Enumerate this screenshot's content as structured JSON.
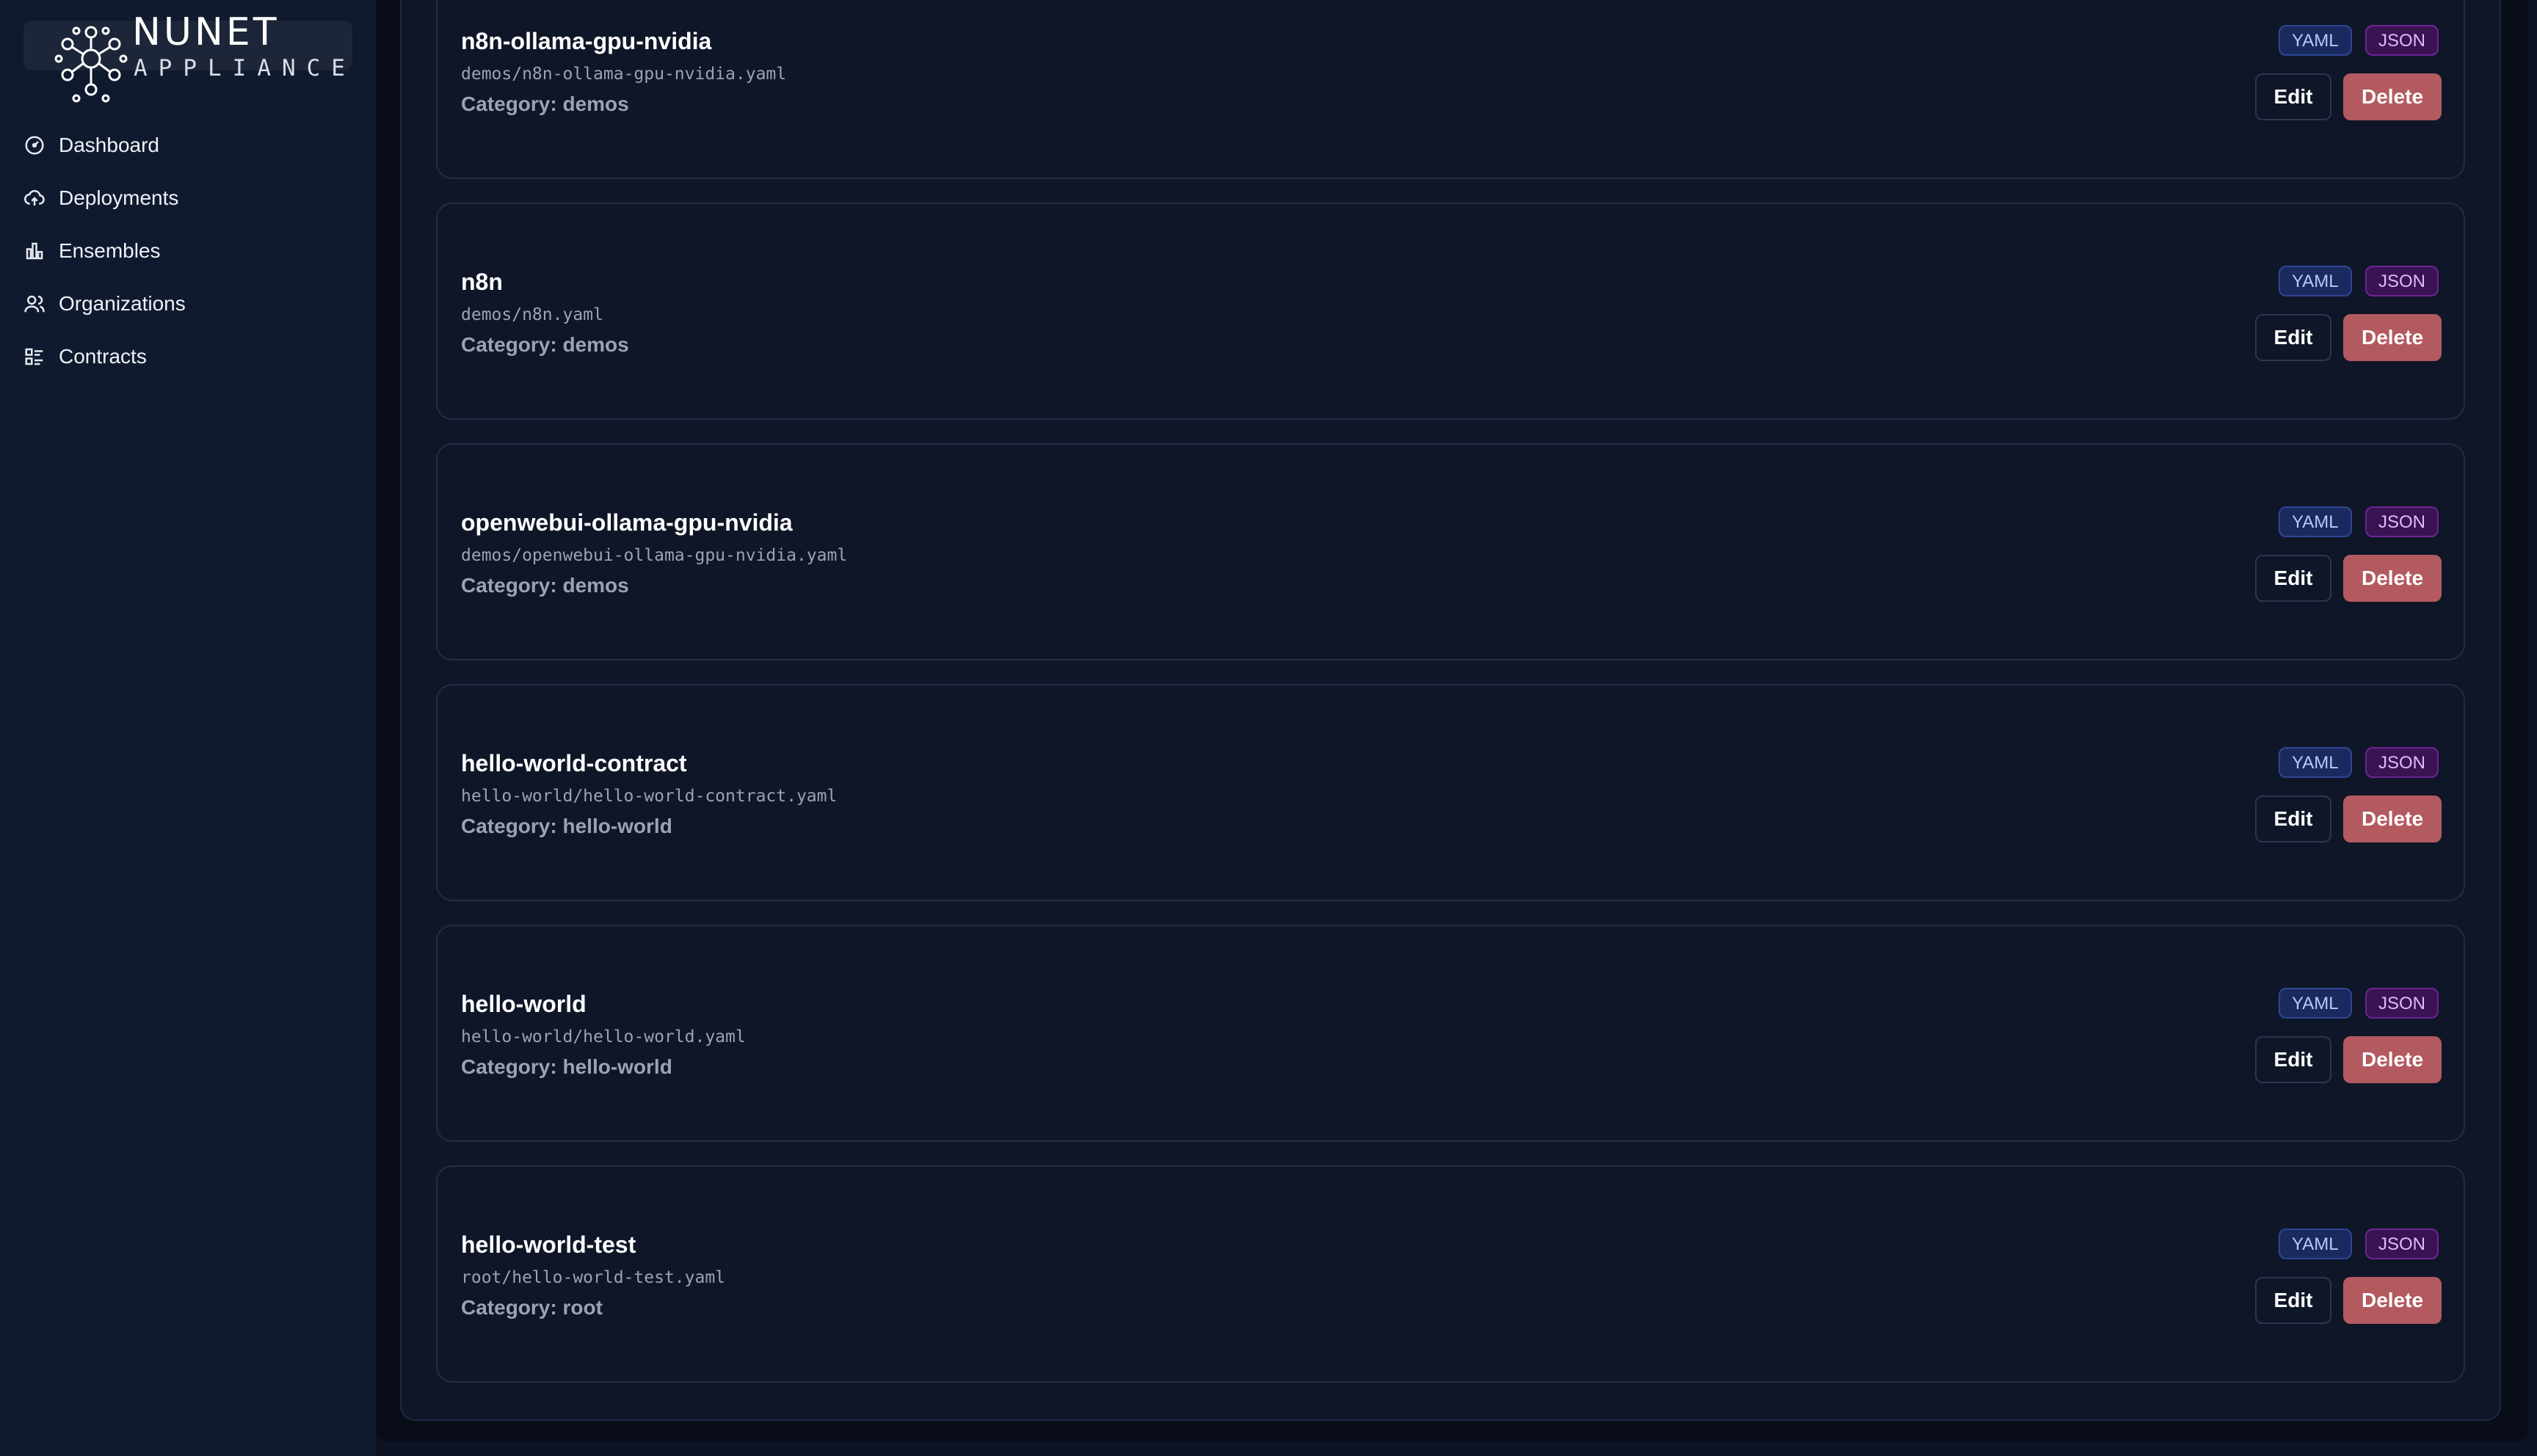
{
  "brand": {
    "name": "NUNET",
    "subtitle": "APPLIANCE"
  },
  "sidebar": {
    "items": [
      {
        "label": "Dashboard",
        "icon": "gauge-icon"
      },
      {
        "label": "Deployments",
        "icon": "cloud-upload-icon"
      },
      {
        "label": "Ensembles",
        "icon": "bar-chart-icon"
      },
      {
        "label": "Organizations",
        "icon": "users-icon"
      },
      {
        "label": "Contracts",
        "icon": "list-checks-icon"
      }
    ]
  },
  "colors": {
    "yaml_badge": "#1b2a5e",
    "json_badge": "#3a1452",
    "delete_button": "#b35a60"
  },
  "card_labels": {
    "category_prefix": "Category:",
    "yaml": "YAML",
    "json": "JSON",
    "edit": "Edit",
    "delete": "Delete"
  },
  "contracts": [
    {
      "name": "n8n-ollama-gpu-nvidia",
      "path": "demos/n8n-ollama-gpu-nvidia.yaml",
      "category": "demos"
    },
    {
      "name": "n8n",
      "path": "demos/n8n.yaml",
      "category": "demos"
    },
    {
      "name": "openwebui-ollama-gpu-nvidia",
      "path": "demos/openwebui-ollama-gpu-nvidia.yaml",
      "category": "demos"
    },
    {
      "name": "hello-world-contract",
      "path": "hello-world/hello-world-contract.yaml",
      "category": "hello-world"
    },
    {
      "name": "hello-world",
      "path": "hello-world/hello-world.yaml",
      "category": "hello-world"
    },
    {
      "name": "hello-world-test",
      "path": "root/hello-world-test.yaml",
      "category": "root"
    }
  ]
}
